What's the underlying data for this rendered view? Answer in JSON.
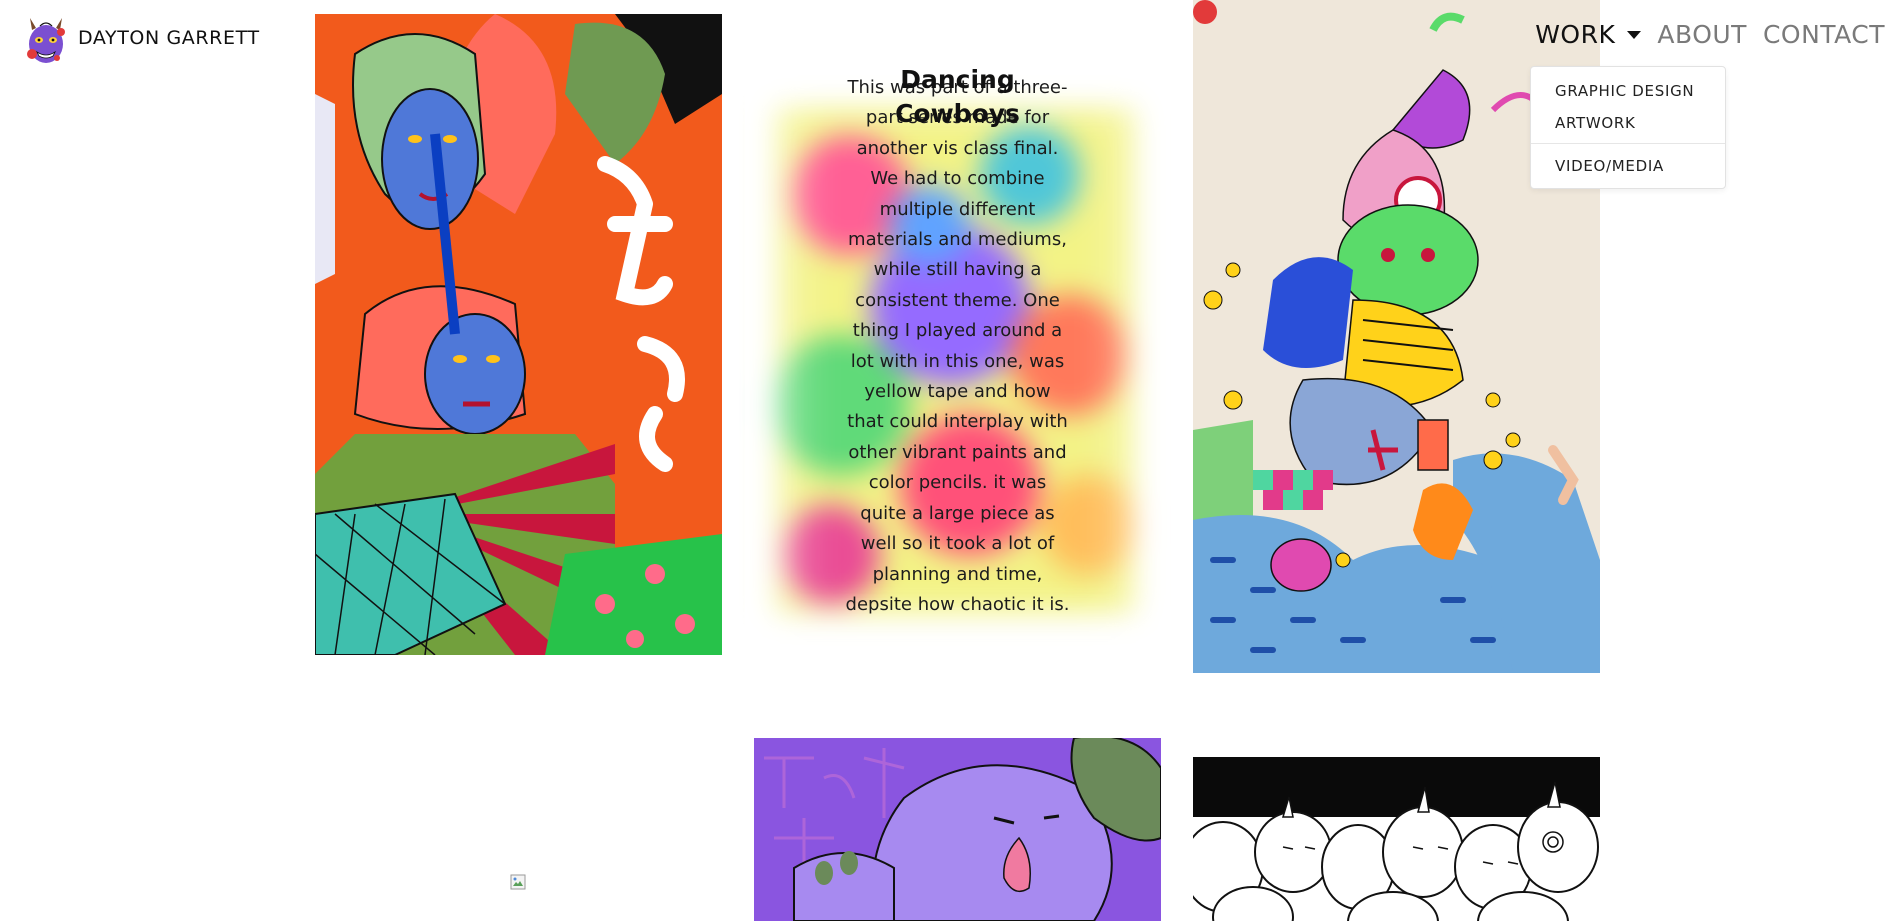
{
  "brand": {
    "name": "DAYTON GARRETT",
    "logo_icon": "oni-mask-logo-icon"
  },
  "nav": {
    "items": [
      {
        "label": "WORK",
        "active": true,
        "has_dropdown": true
      },
      {
        "label": "ABOUT",
        "active": false
      },
      {
        "label": "CONTACT",
        "active": false
      }
    ],
    "dropdown": {
      "items": [
        "GRAPHIC DESIGN",
        "ARTWORK",
        "VIDEO/MEDIA"
      ]
    }
  },
  "gallery": {
    "hovered_piece": {
      "title": "Dancing Cowboys",
      "description": "This was part of a three-part series made for another vis class final. We had to combine multiple different materials and mediums, while still having a consistent theme. One thing I played around a lot with in this one, was yellow tape and how that could interplay with other vibrant paints and color pencils. it was quite a large piece as well so it took a lot of planning and time, depsite how chaotic it is."
    },
    "pieces": [
      {
        "name": "orange-japanese-poster-artwork"
      },
      {
        "name": "character-pile-artwork"
      },
      {
        "name": "purple-character-artwork"
      },
      {
        "name": "black-white-crowd-artwork"
      }
    ]
  },
  "colors": {
    "nav_active": "#111111",
    "nav_inactive": "#7a7a7a",
    "poster_orange": "#f25a1c",
    "purple_bg": "#8a55e0"
  }
}
